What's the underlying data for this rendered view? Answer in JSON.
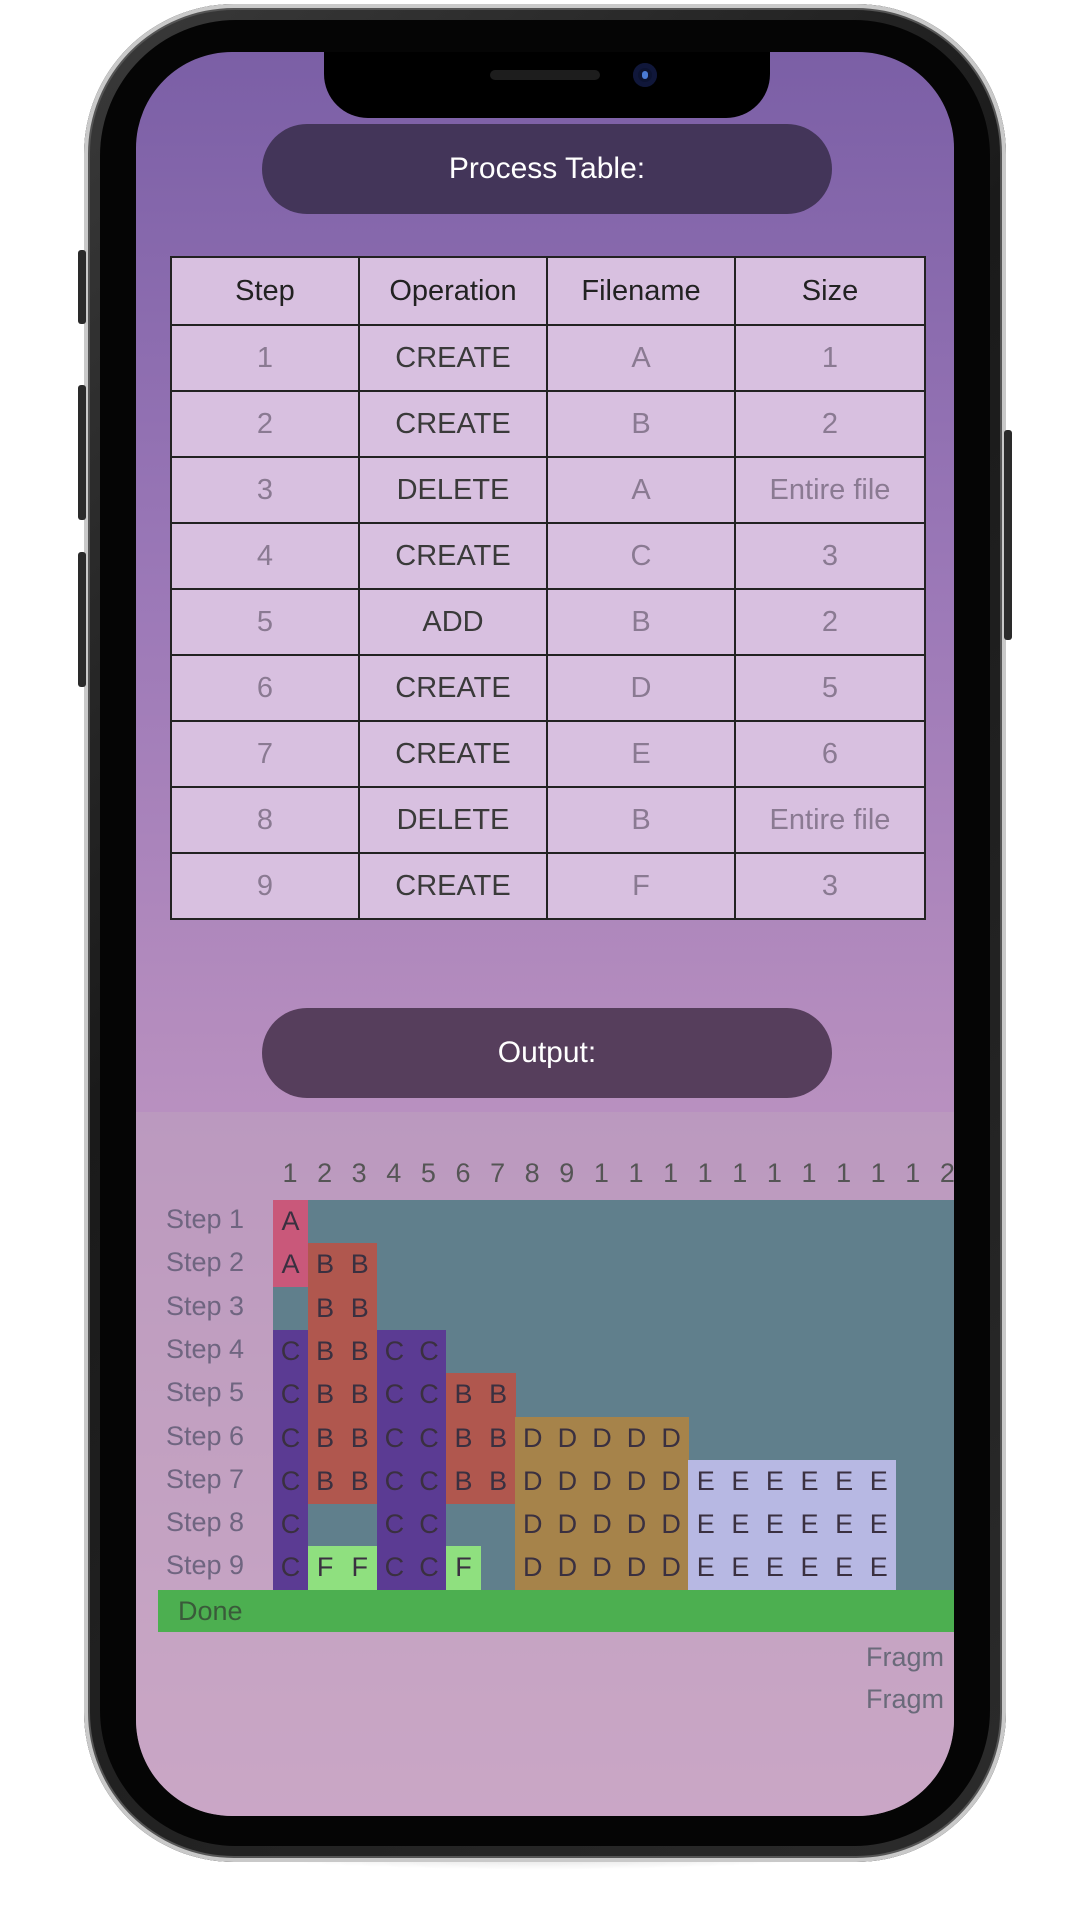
{
  "process_title": "Process Table:",
  "output_title": "Output:",
  "table": {
    "headers": [
      "Step",
      "Operation",
      "Filename",
      "Size"
    ],
    "rows": [
      [
        "1",
        "CREATE",
        "A",
        "1"
      ],
      [
        "2",
        "CREATE",
        "B",
        "2"
      ],
      [
        "3",
        "DELETE",
        "A",
        "Entire file"
      ],
      [
        "4",
        "CREATE",
        "C",
        "3"
      ],
      [
        "5",
        "ADD",
        "B",
        "2"
      ],
      [
        "6",
        "CREATE",
        "D",
        "5"
      ],
      [
        "7",
        "CREATE",
        "E",
        "6"
      ],
      [
        "8",
        "DELETE",
        "B",
        "Entire file"
      ],
      [
        "9",
        "CREATE",
        "F",
        "3"
      ]
    ]
  },
  "output": {
    "block_numbers": [
      "1",
      "2",
      "3",
      "4",
      "5",
      "6",
      "7",
      "8",
      "9",
      "1",
      "1",
      "1",
      "1",
      "1",
      "1",
      "1",
      "1",
      "1",
      "1",
      "2"
    ],
    "step_labels": [
      "Step 1",
      "Step 2",
      "Step 3",
      "Step 4",
      "Step 5",
      "Step 6",
      "Step 7",
      "Step 8",
      "Step 9"
    ],
    "grid": [
      "A",
      "ABB",
      ".BB",
      "CBBCC",
      "CBBCCBB",
      "CBBCCBBDDDDD",
      "CBBCCBBDDDDDEEEEEE",
      "C..CC..DDDDDEEEEEE",
      "CFFCCF.DDDDDEEEEEE"
    ],
    "file_colors": {
      "A": "#c9587a",
      "B": "#b0574e",
      "C": "#5b3b93",
      "D": "#a6834a",
      "E": "#b7b8e3",
      "F": "#8fe07f"
    },
    "done_label": "Done",
    "fragment_lines": [
      "Fragm",
      "Fragm"
    ]
  }
}
